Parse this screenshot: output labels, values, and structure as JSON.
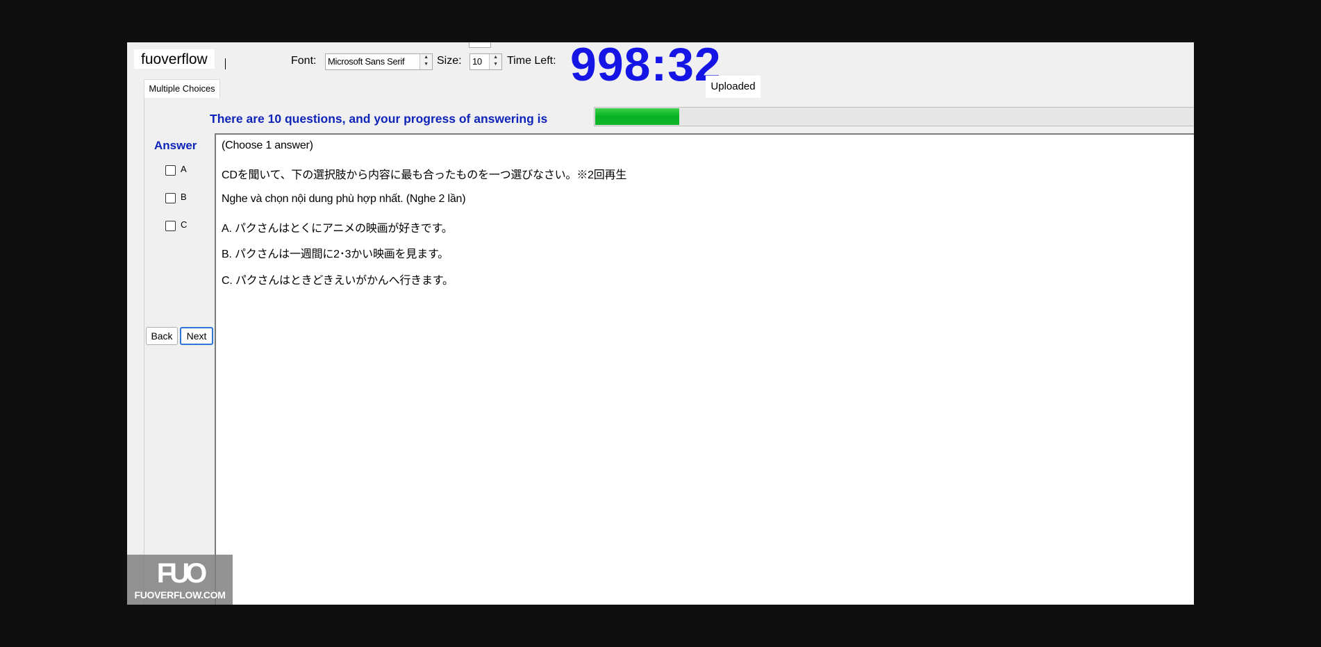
{
  "header": {
    "brand": "fuoverflow",
    "font_label": "Font:",
    "font_value": "Microsoft Sans Serif",
    "size_label": "Size:",
    "size_value": "10",
    "time_left_label": "Time Left:",
    "timer": "998:32"
  },
  "tabs": {
    "multiple_choices": "Multiple Choices"
  },
  "status": {
    "uploaded": "Uploaded"
  },
  "progress": {
    "text": "There are 10 questions, and your progress of answering is",
    "fraction": 0.1
  },
  "answer": {
    "title": "Answer",
    "options": [
      "A",
      "B",
      "C"
    ]
  },
  "nav": {
    "back": "Back",
    "next": "Next"
  },
  "question": {
    "lines": [
      "(Choose 1 answer)",
      "CDを聞いて、下の選択肢から内容に最も合ったものを一つ選びなさい。※2回再生",
      "Nghe và chọn nội dung phù hợp nhất.  (Nghe 2 lần)",
      "A.  パクさんはとくにアニメの映画が好きです。",
      "B.  パクさんは一週間に2･3かい映画を見ます。",
      "C.  パクさんはときどきえいがかんへ行きます。"
    ]
  },
  "watermark": {
    "logo": "FUO",
    "site": "FUOVERFLOW.COM"
  },
  "colors": {
    "timer": "#1515e6",
    "accent_text": "#0f24b8",
    "progress": "#07b223"
  }
}
